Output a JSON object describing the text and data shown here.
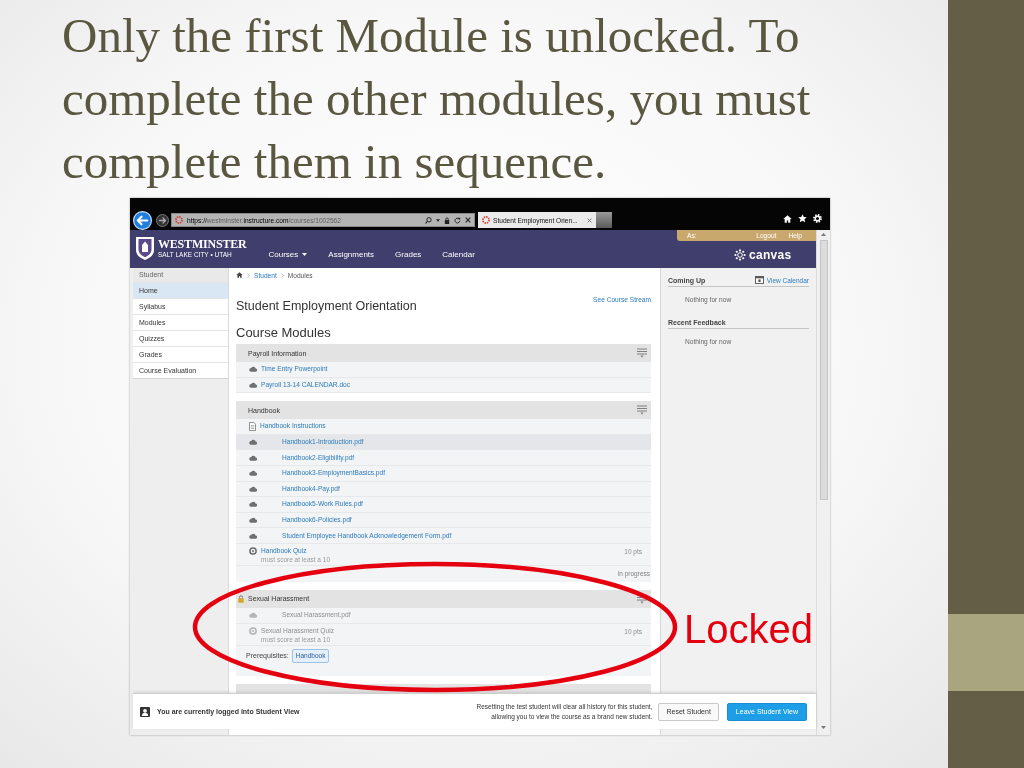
{
  "slide": {
    "title": "Only the first Module is unlocked. To complete the other modules, you must complete them in sequence.",
    "annotation": "Locked"
  },
  "browser": {
    "url": [
      {
        "text": "https://",
        "emphasized": true
      },
      {
        "text": "westminster.",
        "emphasized": false
      },
      {
        "text": "instructure.com",
        "emphasized": true
      },
      {
        "text": "/courses/1002562",
        "emphasized": false
      }
    ],
    "tabs": [
      {
        "title": "Student Employment Orien...",
        "selected": true
      }
    ]
  },
  "header": {
    "logo": {
      "name": "WESTMINSTER",
      "tagline": "SALT LAKE CITY • UTAH"
    },
    "nav": [
      {
        "label": "Courses",
        "dropdown": true
      },
      {
        "label": "Assignments",
        "dropdown": false
      },
      {
        "label": "Grades",
        "dropdown": false
      },
      {
        "label": "Calendar",
        "dropdown": false
      }
    ],
    "user": {
      "prefix": "As:",
      "links": [
        "Logout",
        "Help"
      ]
    },
    "brand": "canvas"
  },
  "course_nav": {
    "heading": "Student",
    "items": [
      {
        "label": "Home",
        "selected": true
      },
      {
        "label": "Syllabus",
        "selected": false
      },
      {
        "label": "Modules",
        "selected": false
      },
      {
        "label": "Quizzes",
        "selected": false
      },
      {
        "label": "Grades",
        "selected": false
      },
      {
        "label": "Course Evaluation",
        "selected": false
      }
    ]
  },
  "breadcrumb": [
    "Student",
    "Modules"
  ],
  "course": {
    "title": "Student Employment Orientation",
    "stream_link": "See Course Stream",
    "section_title": "Course Modules"
  },
  "modules": [
    {
      "name": "Payroll Information",
      "locked": false,
      "items": [
        {
          "kind": "attachment",
          "title": "Time Entry Powerpoint",
          "indented": false,
          "highlighted": false
        },
        {
          "kind": "attachment",
          "title": "Payroll 13-14 CALENDAR.doc",
          "indented": false,
          "highlighted": false
        }
      ]
    },
    {
      "name": "Handbook",
      "locked": false,
      "items": [
        {
          "kind": "page",
          "title": "Handbook Instructions",
          "indented": false,
          "highlighted": false
        },
        {
          "kind": "attachment",
          "title": "Handbook1-Introduction.pdf",
          "indented": true,
          "highlighted": true
        },
        {
          "kind": "attachment",
          "title": "Handbook2-Eligibility.pdf",
          "indented": true,
          "highlighted": false
        },
        {
          "kind": "attachment",
          "title": "Handbook3-EmploymentBasics.pdf",
          "indented": true,
          "highlighted": false
        },
        {
          "kind": "attachment",
          "title": "Handbook4-Pay.pdf",
          "indented": true,
          "highlighted": false
        },
        {
          "kind": "attachment",
          "title": "Handbook5-Work Rules.pdf",
          "indented": true,
          "highlighted": false
        },
        {
          "kind": "attachment",
          "title": "Handbook6-Policies.pdf",
          "indented": true,
          "highlighted": false
        },
        {
          "kind": "attachment",
          "title": "Student Employee Handbook Acknowledgement Form.pdf",
          "indented": true,
          "highlighted": false
        },
        {
          "kind": "quiz",
          "title": "Handbook Quiz",
          "indented": false,
          "highlighted": false,
          "points": "10 pts",
          "requirement": "must score at least a 10"
        }
      ],
      "status": "in progress"
    },
    {
      "name": "Sexual Harassment",
      "locked": true,
      "items": [
        {
          "kind": "attachment",
          "title": "Sexual Harassment.pdf",
          "indented": true,
          "highlighted": false
        },
        {
          "kind": "quiz",
          "title": "Sexual Harassment Quiz",
          "indented": false,
          "highlighted": false,
          "points": "10 pts",
          "requirement": "must score at least a 10"
        }
      ],
      "prerequisites_label": "Prerequisites:",
      "prerequisites": [
        "Handbook"
      ]
    }
  ],
  "sidebar": {
    "sections": [
      {
        "title": "Coming Up",
        "link": "View Calendar",
        "empty_text": "Nothing for now"
      },
      {
        "title": "Recent Feedback",
        "empty_text": "Nothing for now"
      }
    ]
  },
  "student_view": {
    "message": "You are currently logged into Student View",
    "notice": "Resetting the test student will clear all history for this student, allowing you to view the course as a brand new student.",
    "buttons": [
      {
        "label": "Reset Student",
        "kind": "secondary"
      },
      {
        "label": "Leave Student View",
        "kind": "primary"
      }
    ]
  }
}
